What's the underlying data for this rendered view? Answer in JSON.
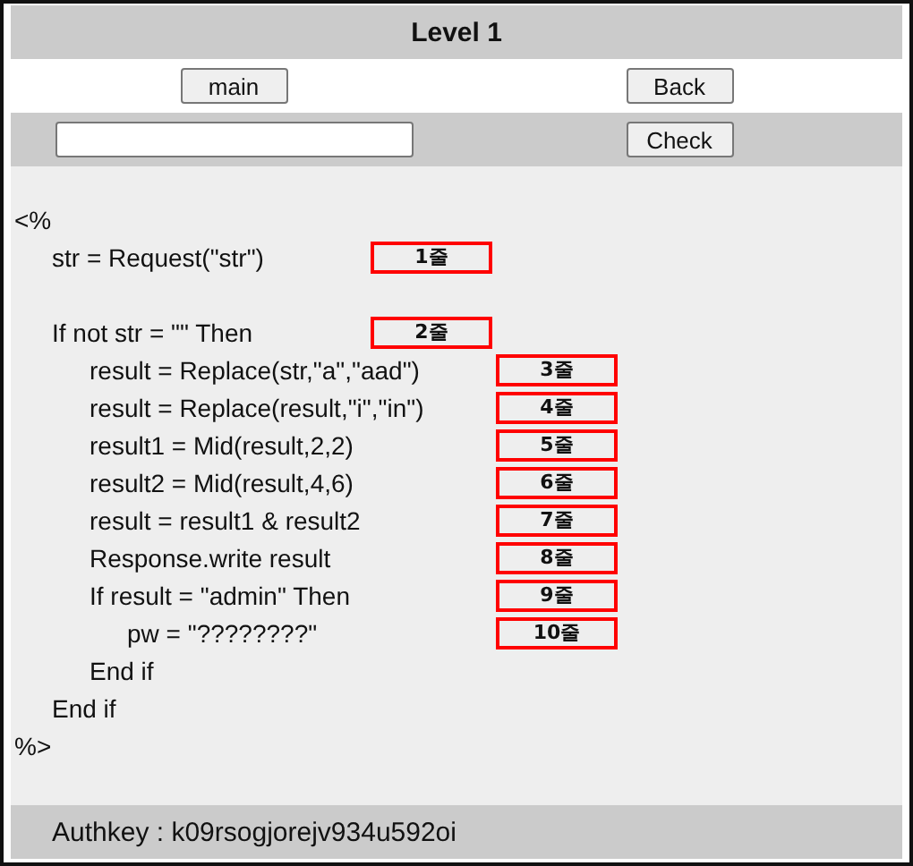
{
  "header": {
    "title": "Level 1"
  },
  "nav_buttons": [
    {
      "label": "main"
    },
    {
      "label": "Back"
    }
  ],
  "answer": {
    "button": "Check"
  },
  "code": [
    {
      "text": "<%",
      "children": [
        {
          "text": "str = Request(\"str\")",
          "note": "1줄"
        },
        {
          "text": "If not str = \"\" Then",
          "note": "2줄",
          "spaced": true,
          "children": [
            {
              "text": "result = Replace(str,\"a\",\"aad\")",
              "note": "3줄"
            },
            {
              "text": "result = Replace(result,\"i\",\"in\")",
              "note": "4줄"
            },
            {
              "text": "result1 = Mid(result,2,2)",
              "note": "5줄"
            },
            {
              "text": "result2 = Mid(result,4,6)",
              "note": "6줄"
            },
            {
              "text": "result = result1 & result2",
              "note": "7줄"
            },
            {
              "text": "Response.write result",
              "note": "8줄"
            },
            {
              "text": "If result = \"admin\" Then",
              "note": "9줄",
              "children": [
                {
                  "text": "pw = \"????????\"",
                  "note": "10줄"
                }
              ]
            },
            {
              "text": "End if"
            }
          ]
        },
        {
          "text": "End if"
        }
      ]
    },
    {
      "text": "%>"
    }
  ],
  "footer": {
    "text": "Authkey : k09rsogjorejv934u592oi"
  }
}
